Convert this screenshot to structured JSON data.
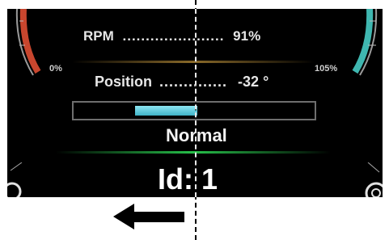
{
  "gauge": {
    "rpm_label": "RPM",
    "rpm_dots": "......................",
    "rpm_value": "91%",
    "position_label": "Position",
    "position_dots": "..............",
    "position_value": "-32 °",
    "left_scale_label": "0%",
    "right_scale_label": "105%",
    "position_bar_fraction": 0.26,
    "status": "Normal",
    "id_text": "Id: 1"
  },
  "icons": {
    "left_arc": "red-gauge-arc",
    "right_arc": "teal-gauge-arc",
    "arrow": "left-arrow-icon",
    "corner_left": "corner-ring-icon",
    "corner_right": "settings-ring-icon"
  },
  "colors": {
    "panel_bg": "#000000",
    "left_arc": "#c8462e",
    "right_arc": "#3fb7b0",
    "position_bar": "#6fd3e3",
    "green_glow": "#27c04a",
    "amber_glow": "#8a6a2a"
  }
}
